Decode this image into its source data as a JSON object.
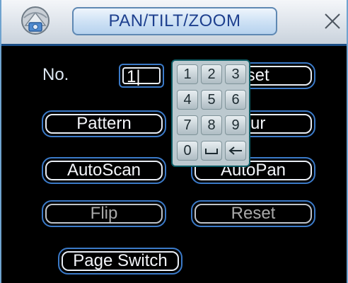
{
  "window": {
    "title": "PAN/TILT/ZOOM",
    "icon": "ptz-camera-icon",
    "close_icon": "close-icon"
  },
  "form": {
    "no_label": "No.",
    "no_value": "1|"
  },
  "buttons": {
    "preset": "eset",
    "pattern": "Pattern",
    "tour": "our",
    "autoscan": "AutoScan",
    "autopan": "AutoPan",
    "flip": "Flip",
    "reset": "Reset",
    "page_switch": "Page Switch"
  },
  "keypad": {
    "keys": [
      "1",
      "2",
      "3",
      "4",
      "5",
      "6",
      "7",
      "8",
      "9",
      "0"
    ],
    "space_icon": "space-key-icon",
    "backspace_icon": "backspace-arrow-icon"
  },
  "colors": {
    "background": "#000000",
    "button_border": "#3b7ac8",
    "title_text": "#1d3f8e",
    "keypad_bg": "#bcc9cf"
  }
}
